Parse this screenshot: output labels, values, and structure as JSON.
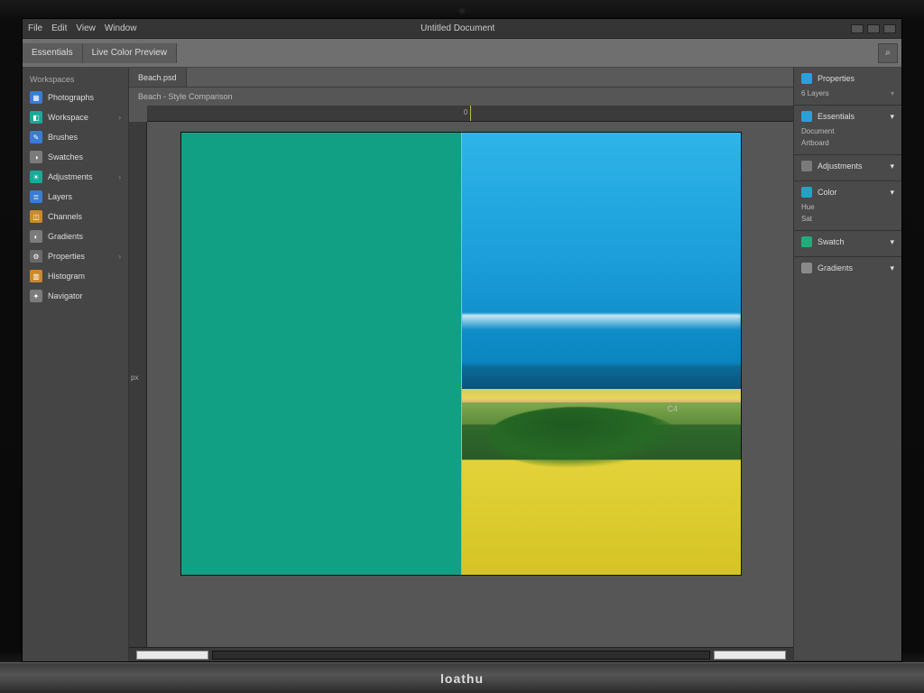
{
  "menubar": {
    "items": [
      "File",
      "Edit",
      "View",
      "Window"
    ],
    "title": "Untitled Document"
  },
  "toolbar": {
    "tabs": [
      "Essentials",
      "Live Color Preview"
    ],
    "right_icons": [
      "search-icon"
    ]
  },
  "sidebar_left": {
    "header": "Workspaces",
    "items": [
      {
        "label": "Photographs",
        "kind": "a",
        "expand": false
      },
      {
        "label": "Workspace",
        "kind": "b",
        "expand": true
      },
      {
        "label": "Brushes",
        "kind": "a",
        "expand": false
      },
      {
        "label": "Swatches",
        "kind": "c",
        "expand": false
      },
      {
        "label": "Adjustments",
        "kind": "b",
        "expand": true
      },
      {
        "label": "Layers",
        "kind": "a",
        "expand": false
      },
      {
        "label": "Channels",
        "kind": "d",
        "expand": false
      },
      {
        "label": "Gradients",
        "kind": "c",
        "expand": false
      },
      {
        "label": "Properties",
        "kind": "e",
        "expand": true
      },
      {
        "label": "Histogram",
        "kind": "d",
        "expand": false
      },
      {
        "label": "Navigator",
        "kind": "c",
        "expand": false
      }
    ]
  },
  "document_tabs": {
    "active": "Beach.psd"
  },
  "subheader": {
    "label": "Beach - Style Comparison"
  },
  "rulers": {
    "h_center": "0",
    "v_label": "px"
  },
  "canvas": {
    "left_fill": "#12a085",
    "right_desc": "coastal-landscape"
  },
  "side_label": "C4",
  "sidebar_right": {
    "status": "Properties",
    "panels": [
      {
        "title": "Essentials",
        "icon": "a",
        "rows": [
          "Document",
          "Artboard"
        ]
      },
      {
        "title": "Adjustments",
        "icon": "b",
        "rows": []
      },
      {
        "title": "Color",
        "icon": "c",
        "rows": [
          "Hue",
          "Sat"
        ]
      },
      {
        "title": "Swatch",
        "icon": "d",
        "rows": []
      },
      {
        "title": "Gradients",
        "icon": "e",
        "rows": []
      }
    ],
    "meta": "6 Layers"
  },
  "brand": "loathu"
}
